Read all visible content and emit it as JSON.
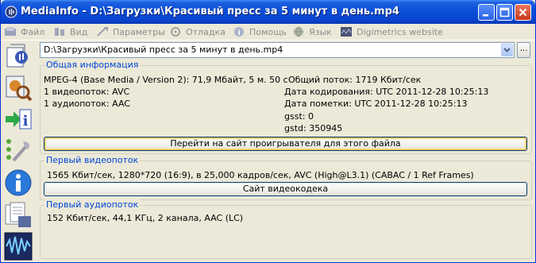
{
  "window": {
    "title": "MediaInfo - D:\\Загрузки\\Красивый пресс за 5 минут в день.mp4"
  },
  "menu": {
    "items": [
      {
        "label": "Файл",
        "icon": "file-icon"
      },
      {
        "label": "Вид",
        "icon": "view-icon"
      },
      {
        "label": "Параметры",
        "icon": "options-icon"
      },
      {
        "label": "Отладка",
        "icon": "debug-icon"
      },
      {
        "label": "Помощь",
        "icon": "help-icon"
      },
      {
        "label": "Язык",
        "icon": "language-icon"
      },
      {
        "label": "Digimetrics website",
        "icon": "digimetrics-icon"
      }
    ]
  },
  "file_selector": {
    "value": "D:\\Загрузки\\Красивый пресс за 5 минут в день.mp4",
    "browse_label": "..."
  },
  "general": {
    "legend": "Общая информация",
    "format_line": "MPEG-4 (Base Media / Version 2): 71,9 Мбайт, 5 м. 50 с",
    "overall": "Общий поток: 1719 Кбит/сек",
    "video_count": "1 видеопоток: AVC",
    "audio_count": "1 аудиопоток: AAC",
    "encoded_date": "Дата кодирования: UTC 2011-12-28 10:25:13",
    "tagged_date": "Дата пометки: UTC 2011-12-28 10:25:13",
    "gsst": "gsst: 0",
    "gstd": "gstd: 350945",
    "player_button": "Перейти на сайт проигрывателя для этого файла"
  },
  "video": {
    "legend": "Первый видеопоток",
    "info": "1565 Кбит/сек, 1280*720 (16:9), в 25,000 кадров/сек, AVC (High@L3.1) (CABAC / 1 Ref Frames)",
    "codec_button": "Сайт видеокодека"
  },
  "audio": {
    "legend": "Первый аудиопоток",
    "info": "152 Кбит/сек, 44,1 КГц, 2 канала, AAC (LC)"
  },
  "colors": {
    "titlebar": "#0a4fd8",
    "legend_text": "#0046d5",
    "window_bg": "#ece9d8"
  }
}
